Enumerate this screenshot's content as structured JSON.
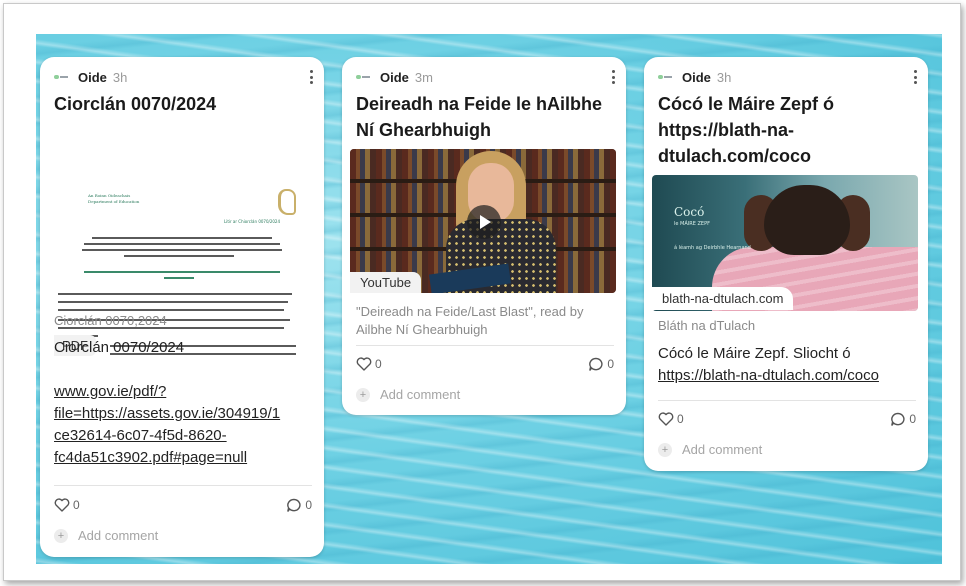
{
  "posts": [
    {
      "author": "Oide",
      "time": "3h",
      "title": "Ciorclán 0070/2024",
      "attachment_type": "PDF",
      "preview_text": {
        "dept": "An Roinn Oideachais\nDepartment of Education",
        "ref": "Litir ar Chiorclán 0070/2024"
      },
      "meta": "Ciorclán 0070,2024",
      "body": "Ciorclán 0070/2024",
      "link": "www.gov.ie/pdf/?file=https://assets.gov.ie/304919/1ce32614-6c07-4f5d-8620-fc4da51c3902.pdf#page=null",
      "link_lines": [
        "www.gov.ie/pdf/?",
        "file=https://assets.gov.ie/304919/1",
        "ce32614-6c07-4f5d-8620-",
        "fc4da51c3902.pdf#page=null"
      ],
      "likes": "0",
      "comments": "0",
      "add_comment": "Add comment"
    },
    {
      "author": "Oide",
      "time": "3m",
      "title": "Deireadh na Feide le hAilbhe Ní Ghearbhuigh",
      "attachment_type": "YouTube",
      "meta": "\"Deireadh na Feide/Last Blast\", read by Ailbhe Ní Ghearbhuigh",
      "likes": "0",
      "comments": "0",
      "add_comment": "Add comment"
    },
    {
      "author": "Oide",
      "time": "3h",
      "title": "Cócó le Máire Zepf ó https://blath-na-dtulach.com/coco",
      "attachment_type": "blath-na-dtulach.com",
      "cover": {
        "title": "Cocó",
        "subtitle": "le MÁIRE ZEPF",
        "illustrator": "á léamh ag Deirbhle Hearnand"
      },
      "meta": "Bláth na dTulach",
      "body_prefix": "Cócó le Máire Zepf. Sliocht ó",
      "link": "https://blath-na-dtulach.com/coco",
      "likes": "0",
      "comments": "0",
      "add_comment": "Add comment"
    }
  ]
}
